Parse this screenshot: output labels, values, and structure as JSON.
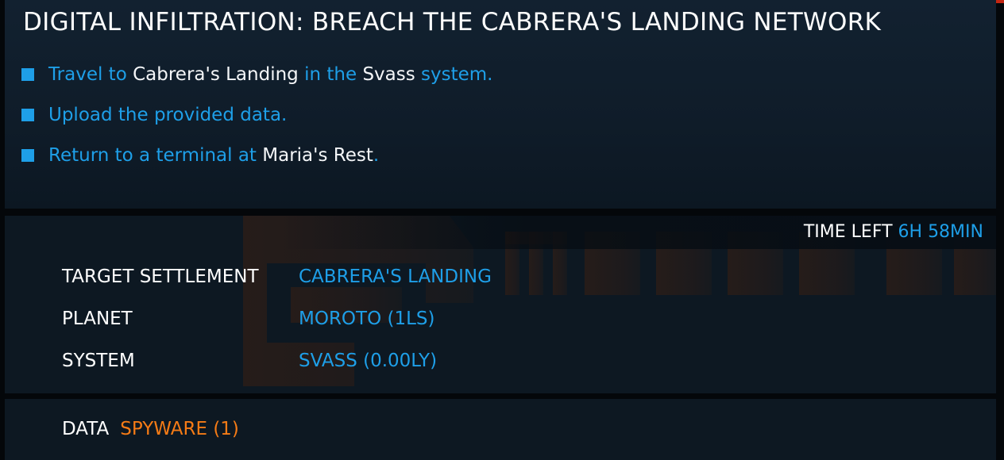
{
  "mission": {
    "title": "DIGITAL INFILTRATION: BREACH THE CABRERA'S LANDING NETWORK",
    "objectives": [
      {
        "parts": [
          {
            "text": "Travel to",
            "style": "blue"
          },
          {
            "text": "Cabrera's Landing",
            "style": "white"
          },
          {
            "text": "in the",
            "style": "blue"
          },
          {
            "text": "Svass",
            "style": "white"
          },
          {
            "text": "system.",
            "style": "blue"
          }
        ]
      },
      {
        "parts": [
          {
            "text": "Upload the provided data.",
            "style": "blue"
          }
        ]
      },
      {
        "parts": [
          {
            "text": "Return to a terminal at",
            "style": "blue"
          },
          {
            "text": "Maria's Rest",
            "style": "white"
          },
          {
            "text": ".",
            "style": "blue"
          }
        ]
      }
    ]
  },
  "time_left": {
    "label": "TIME LEFT",
    "value": "6H 58MIN"
  },
  "details": {
    "target_settlement": {
      "label": "TARGET SETTLEMENT",
      "value": "CABRERA'S LANDING"
    },
    "planet": {
      "label": "PLANET",
      "value": "MOROTO (1LS)"
    },
    "system": {
      "label": "SYSTEM",
      "value": "SVASS (0.00LY)"
    }
  },
  "cargo": {
    "label": "DATA",
    "value": "SPYWARE (1)"
  },
  "icons": {
    "objective_bullet": "square-bullet-icon",
    "watermark": "faction-logo-watermark"
  },
  "colors": {
    "accent_blue": "#1e9fe8",
    "accent_orange": "#f57b16",
    "text_white": "#ffffff",
    "panel_bg": "#0d1822",
    "alert_red": "#c42612"
  }
}
